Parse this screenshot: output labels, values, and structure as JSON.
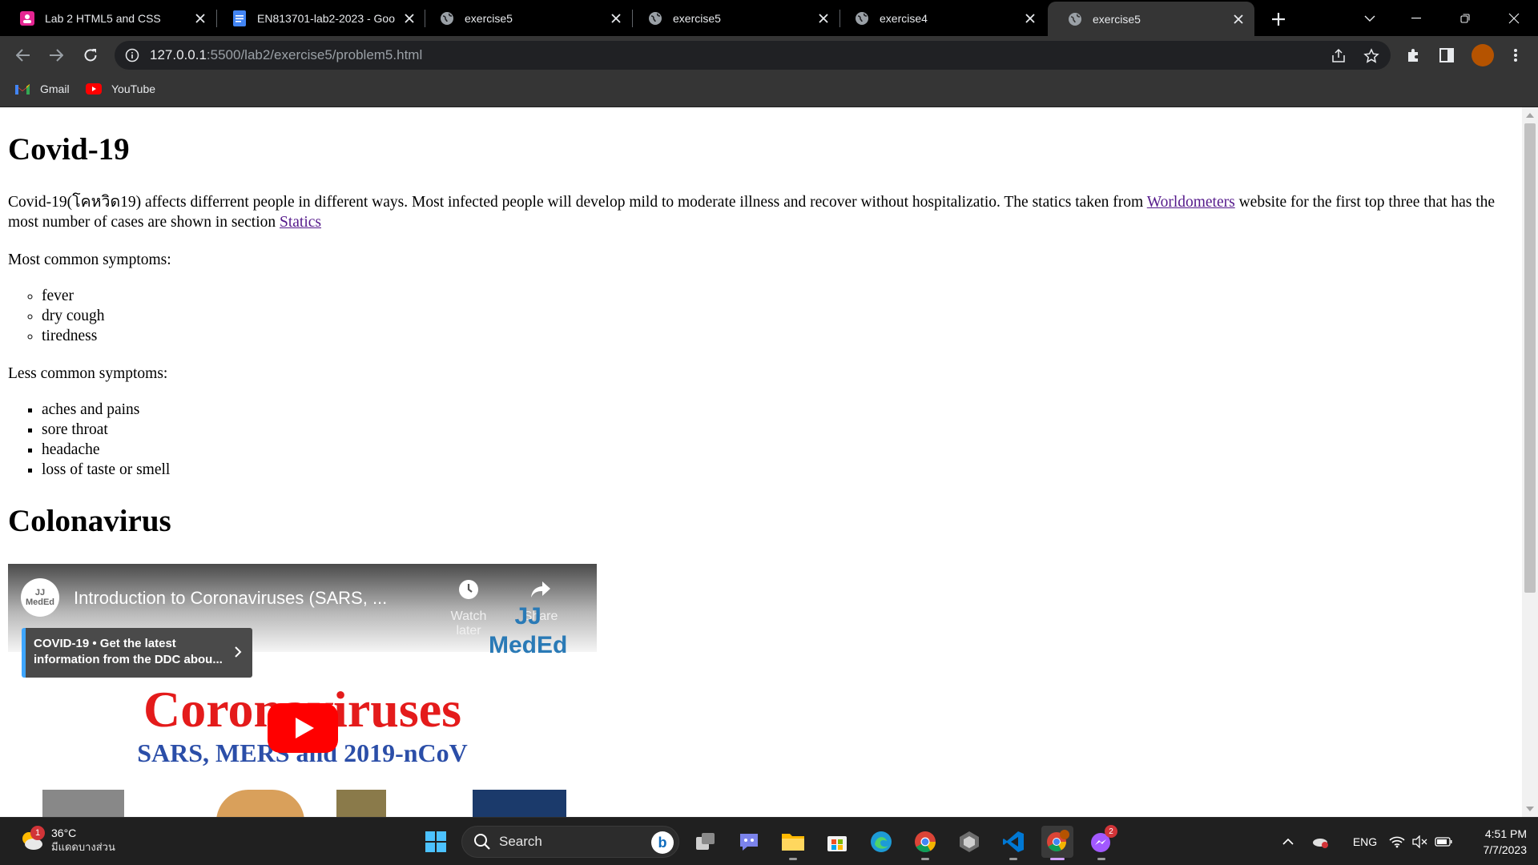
{
  "browser": {
    "tabs": [
      {
        "title": "Lab 2 HTML5 and CSS",
        "icon": "classroom-icon",
        "active": false
      },
      {
        "title": "EN813701-lab2-2023 - Goo",
        "icon": "docs-icon",
        "active": false
      },
      {
        "title": "exercise5",
        "icon": "globe-icon",
        "active": false
      },
      {
        "title": "exercise5",
        "icon": "globe-icon",
        "active": false
      },
      {
        "title": "exercise4",
        "icon": "globe-icon",
        "active": false
      },
      {
        "title": "exercise5",
        "icon": "globe-icon",
        "active": true
      }
    ],
    "address": {
      "host": "127.0.0.1",
      "rest": ":5500/lab2/exercise5/problem5.html"
    },
    "bookmarks": [
      {
        "label": "Gmail",
        "icon": "gmail-icon"
      },
      {
        "label": "YouTube",
        "icon": "youtube-icon"
      }
    ],
    "colors": {
      "frame": "#000000",
      "toolbar": "#353535",
      "profile": "#b55300"
    }
  },
  "page": {
    "heading1": "Covid-19",
    "intro": {
      "before_link1": "Covid-19(โคหวิด19) affects differrent people in different ways. Most infected people will develop mild to moderate illness and recover without hospitalizatio. The statics taken from ",
      "link1": "Worldometers",
      "between": " website for the first top three that has the most number of cases are shown in section ",
      "link2": "Statics"
    },
    "most_common_label": "Most common symptoms:",
    "most_common": [
      "fever",
      "dry cough",
      "tiredness"
    ],
    "less_common_label": "Less common symptoms:",
    "less_common": [
      "aches and pains",
      "sore throat",
      "headache",
      "loss of taste or smell"
    ],
    "heading2": "Colonavirus",
    "video": {
      "title": "Introduction to Coronaviruses (SARS, ...",
      "channel_avatar": "JJ MedEd",
      "watch_later": "Watch later",
      "share": "Share",
      "card_text": "COVID-19 • Get the latest information from the DDC abou...",
      "brand_line1": "JJ",
      "brand_line2": "MedEd",
      "headline": "Coronaviruses",
      "subline": "SARS, MERS and 2019-nCoV"
    }
  },
  "taskbar": {
    "weather": {
      "temp": "36°C",
      "condition": "มีแดดบางส่วน",
      "badge": "1"
    },
    "search_placeholder": "Search",
    "apps": [
      "windows-start-icon",
      "task-view-icon",
      "teams-chat-icon",
      "file-explorer-icon",
      "microsoft-store-icon",
      "edge-icon",
      "chrome-icon",
      "app-icon",
      "vscode-icon",
      "chrome-profile-icon",
      "messenger-icon"
    ],
    "messenger_badge": "2",
    "language": "ENG",
    "time": "4:51 PM",
    "date": "7/7/2023"
  }
}
